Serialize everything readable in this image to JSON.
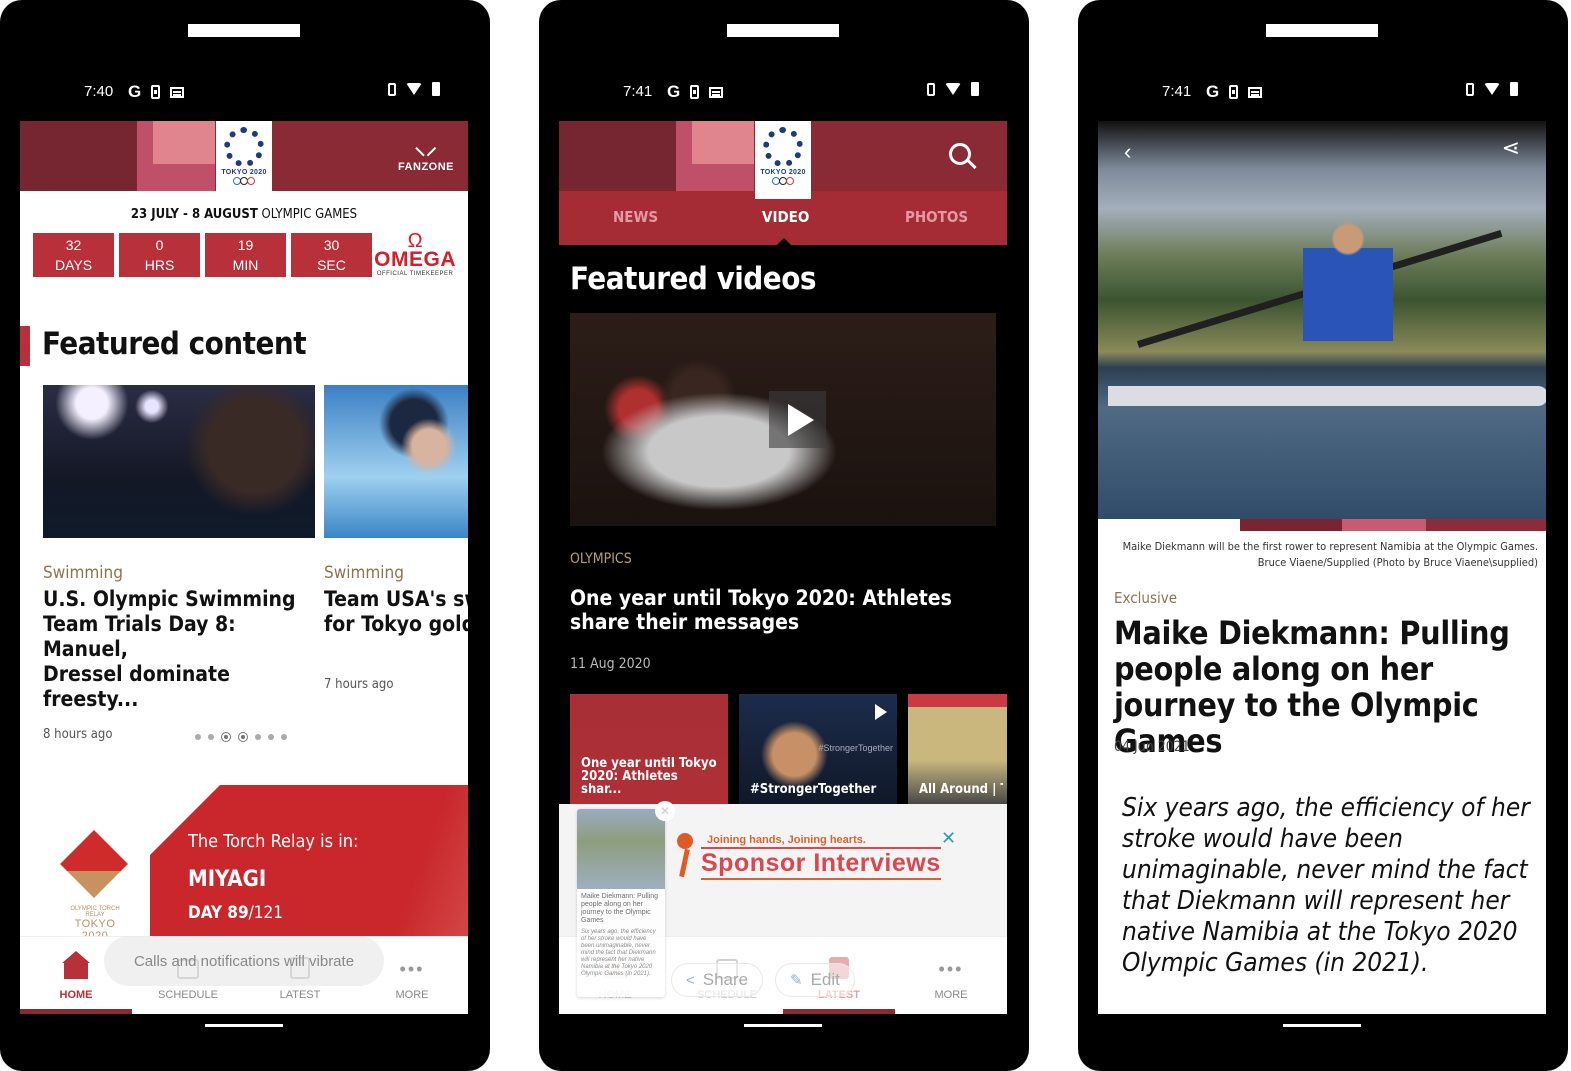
{
  "phones": [
    {
      "status": {
        "time": "7:40"
      },
      "header": {
        "logo_text": "TOKYO 2020",
        "fanzone_label": "FANZONE"
      },
      "countdown": {
        "dates_bold": "23 JULY - 8 AUGUST",
        "dates_rest": " OLYMPIC GAMES",
        "cells": [
          {
            "value": "32",
            "unit": "DAYS"
          },
          {
            "value": "0",
            "unit": "HRS"
          },
          {
            "value": "19",
            "unit": "MIN"
          },
          {
            "value": "30",
            "unit": "SEC"
          }
        ],
        "sponsor": {
          "symbol": "Ω",
          "name": "OMEGA",
          "tagline": "OFFICIAL TIMEKEEPER"
        }
      },
      "featured": {
        "title": "Featured content",
        "cards": [
          {
            "category": "Swimming",
            "title": "U.S. Olympic Swimming\nTeam Trials Day 8: Manuel,\nDressel dominate freesty...",
            "time": "8 hours ago"
          },
          {
            "category": "Swimming",
            "title": "Team USA's sw\nfor Tokyo gold",
            "time": "7 hours ago"
          }
        ],
        "pager": {
          "total": 7,
          "active": 3
        }
      },
      "torch": {
        "logo_sub": "OLYMPIC TORCH RELAY",
        "logo_main": "TOKYO 2020",
        "label": "The Torch Relay is in:",
        "city": "MIYAGI",
        "day_prefix": "DAY 89",
        "day_suffix": "/121"
      },
      "toast": "Calls and notifications will vibrate",
      "nav": [
        {
          "label": "HOME",
          "icon": "home-icon",
          "active": true
        },
        {
          "label": "SCHEDULE",
          "icon": "calendar-icon",
          "active": false
        },
        {
          "label": "LATEST",
          "icon": "latest-icon",
          "active": false
        },
        {
          "label": "MORE",
          "icon": "more-icon",
          "active": false
        }
      ]
    },
    {
      "status": {
        "time": "7:41"
      },
      "header": {
        "logo_text": "TOKYO 2020"
      },
      "tabs": [
        {
          "label": "NEWS",
          "active": false
        },
        {
          "label": "VIDEO",
          "active": true
        },
        {
          "label": "PHOTOS",
          "active": false
        }
      ],
      "section_title": "Featured videos",
      "main_video": {
        "category": "OLYMPICS",
        "title": "One year until Tokyo 2020: Athletes share their messages",
        "date": "11 Aug 2020"
      },
      "thumbnails": [
        {
          "title": "One year until Tokyo 2020: Athletes shar..."
        },
        {
          "title": "#StrongerTogether",
          "overlay_tag": "#StrongerTogether"
        },
        {
          "title": "All Around | Ti Refocus"
        }
      ],
      "ad": {
        "tagline": "Joining hands, Joining hearts.",
        "headline": "Sponsor Interviews",
        "mini_title": "Maike Diekmann: Pulling people along on her journey to the Olympic Games",
        "mini_quote": "Six years ago, the efficiency of her stroke would have been unimaginable, never mind the fact that Diekmann will represent her native Namibia at the Tokyo 2020 Olympic Games (in 2021)."
      },
      "chips": [
        {
          "label": "Share",
          "icon": "share-icon"
        },
        {
          "label": "Edit",
          "icon": "pencil-icon"
        }
      ],
      "nav": [
        {
          "label": "HOME",
          "active": false
        },
        {
          "label": "SCHEDULE",
          "active": false
        },
        {
          "label": "LATEST",
          "active": true
        },
        {
          "label": "MORE",
          "active": false
        }
      ]
    },
    {
      "status": {
        "time": "7:41"
      },
      "article": {
        "caption_line1": "Maike Diekmann will be the first rower to represent Namibia at the Olympic Games.",
        "caption_line2": "Bruce Viaene/Supplied (Photo by Bruce Viaene\\supplied)",
        "category": "Exclusive",
        "title": "Maike Diekmann: Pulling people along on her journey to the Olympic Games",
        "date": "04 Jun 2021",
        "quote": "Six years ago, the efficiency of her stroke would have been unimaginable, never mind the fact that Diekmann will represent her native Namibia at the Tokyo 2020 Olympic Games (in 2021)."
      }
    }
  ]
}
